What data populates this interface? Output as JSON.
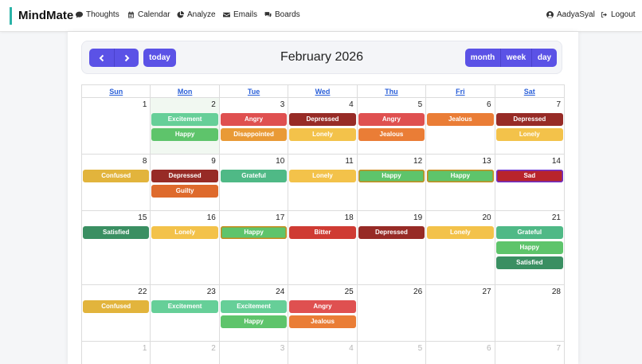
{
  "nav": {
    "brand": "MindMate",
    "items": [
      {
        "label": "Thoughts",
        "icon": "chat-icon"
      },
      {
        "label": "Calendar",
        "icon": "calendar-icon"
      },
      {
        "label": "Analyze",
        "icon": "pie-chart-icon"
      },
      {
        "label": "Emails",
        "icon": "envelope-icon"
      },
      {
        "label": "Boards",
        "icon": "boards-icon"
      }
    ],
    "user": "AadyaSyal",
    "logout": "Logout"
  },
  "toolbar": {
    "title": "February 2026",
    "today": "today",
    "views": [
      "month",
      "week",
      "day"
    ]
  },
  "weekdays": [
    "Sun",
    "Mon",
    "Tue",
    "Wed",
    "Thu",
    "Fri",
    "Sat"
  ],
  "colors": {
    "Excitement": "#66cf98",
    "Happy": "#5ec46b",
    "Angry": "#df5050",
    "Disappointed": "#e99a36",
    "Depressed": "#972b26",
    "Lonely": "#f3c24a",
    "Jealous": "#ea7d36",
    "Confused": "#e2b43c",
    "Guilty": "#de6a2c",
    "Grateful": "#4fb986",
    "Sad": "#b8242b",
    "Satisfied": "#3a8f62",
    "Bitter": "#cf3b33"
  },
  "weeks": [
    [
      {
        "n": "1",
        "events": []
      },
      {
        "n": "2",
        "today": true,
        "events": [
          "Excitement",
          "Happy"
        ]
      },
      {
        "n": "3",
        "events": [
          "Angry",
          "Disappointed"
        ]
      },
      {
        "n": "4",
        "events": [
          "Depressed",
          "Lonely"
        ]
      },
      {
        "n": "5",
        "events": [
          "Angry",
          "Jealous"
        ]
      },
      {
        "n": "6",
        "events": [
          "Jealous"
        ]
      },
      {
        "n": "7",
        "events": [
          "Depressed",
          "Lonely"
        ]
      }
    ],
    [
      {
        "n": "8",
        "events": [
          "Confused"
        ]
      },
      {
        "n": "9",
        "events": [
          "Depressed",
          "Guilty"
        ]
      },
      {
        "n": "10",
        "events": [
          "Grateful"
        ]
      },
      {
        "n": "11",
        "events": [
          "Lonely"
        ]
      },
      {
        "n": "12",
        "events": [
          "Happy"
        ],
        "selected": "orange"
      },
      {
        "n": "13",
        "events": [
          "Happy"
        ],
        "selected": "orange"
      },
      {
        "n": "14",
        "events": [
          "Sad"
        ],
        "selected": "purple"
      }
    ],
    [
      {
        "n": "15",
        "events": [
          "Satisfied"
        ]
      },
      {
        "n": "16",
        "events": [
          "Lonely"
        ]
      },
      {
        "n": "17",
        "events": [
          "Happy"
        ],
        "selected": "orange"
      },
      {
        "n": "18",
        "events": [
          "Bitter"
        ]
      },
      {
        "n": "19",
        "events": [
          "Depressed"
        ]
      },
      {
        "n": "20",
        "events": [
          "Lonely"
        ]
      },
      {
        "n": "21",
        "events": [
          "Grateful",
          "Happy",
          "Satisfied"
        ]
      }
    ],
    [
      {
        "n": "22",
        "events": [
          "Confused"
        ]
      },
      {
        "n": "23",
        "events": [
          "Excitement"
        ]
      },
      {
        "n": "24",
        "events": [
          "Excitement",
          "Happy"
        ]
      },
      {
        "n": "25",
        "events": [
          "Angry",
          "Jealous"
        ]
      },
      {
        "n": "26",
        "events": []
      },
      {
        "n": "27",
        "events": []
      },
      {
        "n": "28",
        "events": []
      }
    ],
    [
      {
        "n": "1",
        "other": true,
        "events": []
      },
      {
        "n": "2",
        "other": true,
        "events": []
      },
      {
        "n": "3",
        "other": true,
        "events": []
      },
      {
        "n": "4",
        "other": true,
        "events": []
      },
      {
        "n": "5",
        "other": true,
        "events": []
      },
      {
        "n": "6",
        "other": true,
        "events": []
      },
      {
        "n": "7",
        "other": true,
        "events": []
      }
    ]
  ]
}
